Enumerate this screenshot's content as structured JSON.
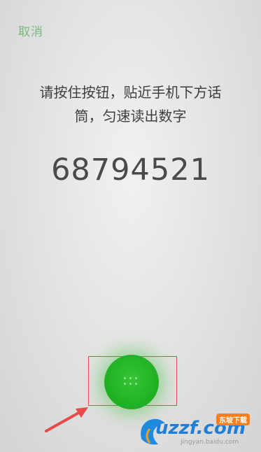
{
  "header": {
    "cancel_label": "取消"
  },
  "prompt": {
    "line1": "请按住按钮，贴近手机下方话",
    "line2": "筒，匀速读出数字"
  },
  "verification": {
    "digits": "68794521"
  },
  "record_button": {
    "icon": "keypad-dots-icon",
    "color": "#22b022"
  },
  "annotations": {
    "highlight_color": "#e84a4a"
  },
  "watermark": {
    "brand": "uzzf.com",
    "badge": "东坡下载",
    "site": "jingyan.baidu.com"
  }
}
